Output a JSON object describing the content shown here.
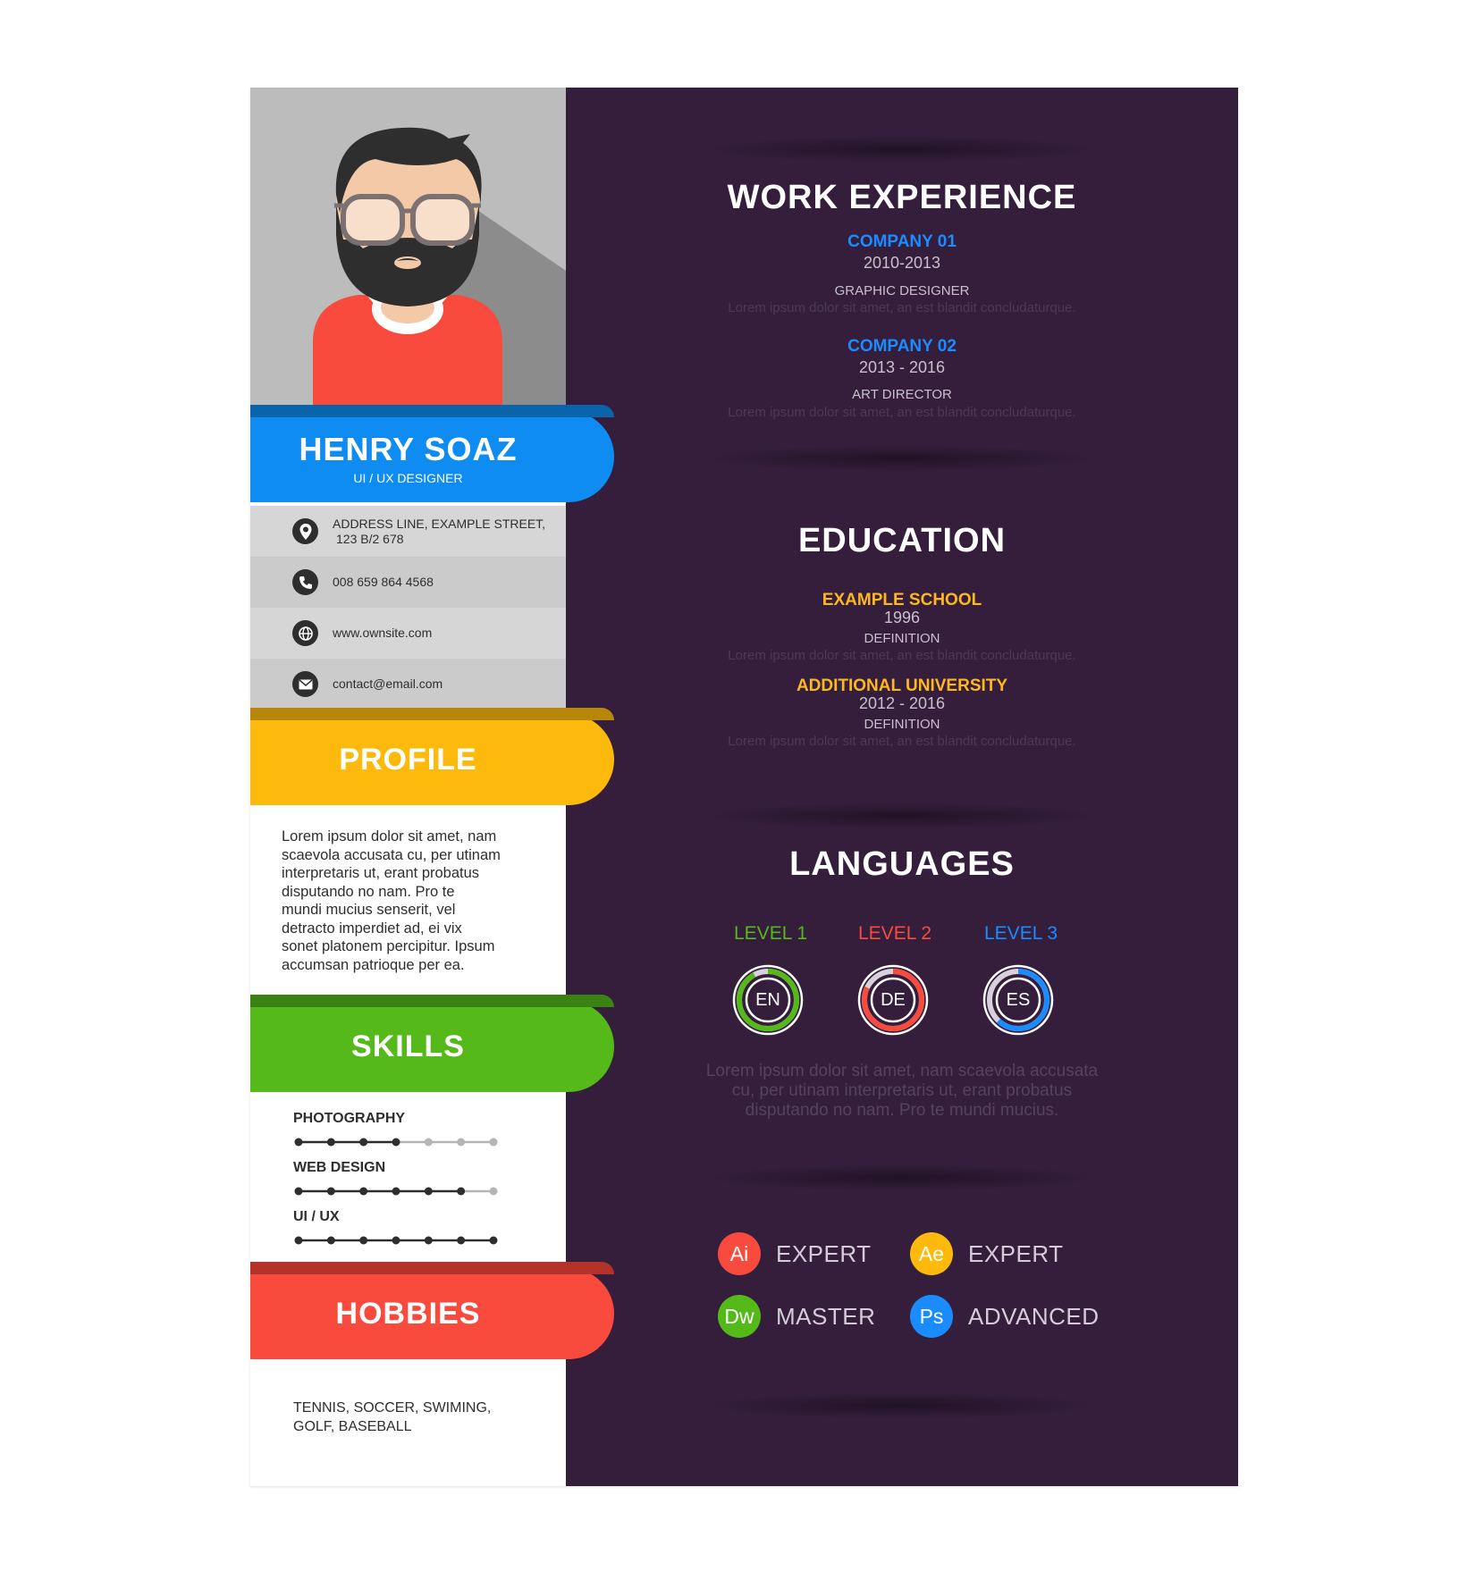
{
  "colors": {
    "blue": "#0f8cf1",
    "yellow": "#fdba0c",
    "green": "#55b91a",
    "red": "#f84b3d",
    "purple": "#341e3c",
    "gray": "#bcbcbc"
  },
  "header": {
    "name": "HENRY SOAZ",
    "title": "UI / UX DESIGNER"
  },
  "contact": {
    "address_line1": "ADDRESS LINE, EXAMPLE STREET,",
    "address_line2": "123 B/2 678",
    "phone": "008 659 864 4568",
    "website": "www.ownsite.com",
    "email": "contact@email.com",
    "icons": [
      "location-pin-icon",
      "phone-icon",
      "globe-icon",
      "envelope-icon"
    ]
  },
  "profile": {
    "heading": "PROFILE",
    "lines": [
      "Lorem ipsum dolor sit amet, nam",
      "scaevola accusata cu, per utinam",
      "interpretaris ut, erant probatus",
      "disputando no nam. Pro te",
      "mundi mucius senserit, vel",
      "detracto imperdiet ad, ei vix",
      "sonet platonem percipitur. Ipsum",
      "accumsan patrioque per ea."
    ]
  },
  "skills": {
    "heading": "SKILLS",
    "items": [
      {
        "label": "PHOTOGRAPHY",
        "level": 4,
        "max": 7
      },
      {
        "label": "WEB DESIGN",
        "level": 6,
        "max": 7
      },
      {
        "label": "UI / UX",
        "level": 7,
        "max": 7
      }
    ]
  },
  "hobbies": {
    "heading": "HOBBIES",
    "line1": "TENNIS, SOCCER, SWIMING,",
    "line2": "GOLF, BASEBALL"
  },
  "work": {
    "heading": "WORK EXPERIENCE",
    "items": [
      {
        "company": "COMPANY 01",
        "years": "2010-2013",
        "role": "GRAPHIC DESIGNER",
        "desc": "Lorem ipsum dolor sit amet, an est blandit concludaturque."
      },
      {
        "company": "COMPANY 02",
        "years": "2013 - 2016",
        "role": "ART DIRECTOR",
        "desc": "Lorem ipsum dolor sit amet, an est blandit concludaturque."
      }
    ]
  },
  "education": {
    "heading": "EDUCATION",
    "items": [
      {
        "school": "EXAMPLE SCHOOL",
        "years": "1996",
        "definition": "DEFINITION",
        "desc": "Lorem ipsum dolor sit amet, an est blandit concludaturque."
      },
      {
        "school": "ADDITIONAL UNIVERSITY",
        "years": "2012 - 2016",
        "definition": "DEFINITION",
        "desc": "Lorem ipsum dolor sit amet, an est blandit concludaturque."
      }
    ]
  },
  "languages": {
    "heading": "LANGUAGES",
    "items": [
      {
        "level": "LEVEL 1",
        "code": "EN",
        "color": "#55b91a",
        "fill": 0.92
      },
      {
        "level": "LEVEL 2",
        "code": "DE",
        "color": "#f84b3d",
        "fill": 0.82
      },
      {
        "level": "LEVEL 3",
        "code": "ES",
        "color": "#1a8cff",
        "fill": 0.62
      }
    ],
    "desc_lines": [
      "Lorem ipsum dolor sit amet, nam scaevola accusata",
      "cu, per utinam interpretaris ut, erant probatus",
      "disputando no nam. Pro te mundi mucius."
    ]
  },
  "tools": [
    {
      "abbr": "Ai",
      "level": "EXPERT",
      "color": "#f84b3d"
    },
    {
      "abbr": "Ae",
      "level": "EXPERT",
      "color": "#fdba0c"
    },
    {
      "abbr": "Dw",
      "level": "MASTER",
      "color": "#55b91a"
    },
    {
      "abbr": "Ps",
      "level": "ADVANCED",
      "color": "#1a8cff"
    }
  ]
}
